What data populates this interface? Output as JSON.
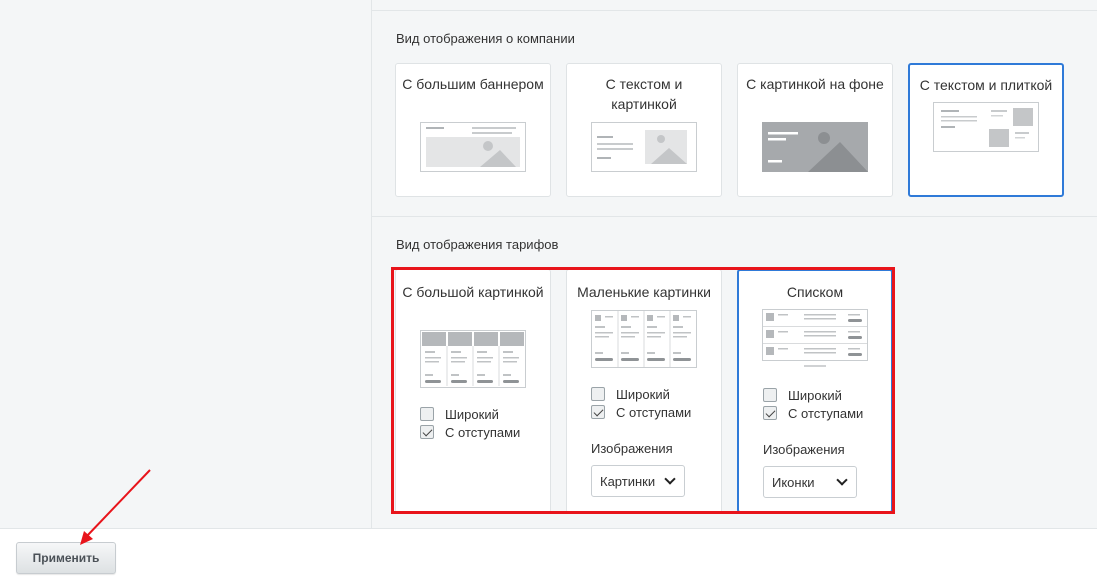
{
  "company_section": {
    "title": "Вид отображения о компании",
    "cards": [
      {
        "label": "С большим баннером",
        "selected": false
      },
      {
        "label": "С текстом и картинкой",
        "selected": false
      },
      {
        "label": "С картинкой на фоне",
        "selected": false
      },
      {
        "label": "С текстом и плиткой",
        "selected": true
      }
    ]
  },
  "tariff_section": {
    "title": "Вид отображения тарифов",
    "cards": [
      {
        "label": "С большой картинкой",
        "selected": false,
        "wide_label": "Широкий",
        "wide_checked": false,
        "padding_label": "С отступами",
        "padding_checked": true
      },
      {
        "label": "Маленькие картинки",
        "selected": false,
        "wide_label": "Широкий",
        "wide_checked": false,
        "padding_label": "С отступами",
        "padding_checked": true,
        "images_label": "Изображения",
        "images_value": "Картинки"
      },
      {
        "label": "Списком",
        "selected": true,
        "wide_label": "Широкий",
        "wide_checked": false,
        "padding_label": "С отступами",
        "padding_checked": true,
        "images_label": "Изображения",
        "images_value": "Иконки"
      }
    ]
  },
  "footer": {
    "apply_label": "Применить"
  },
  "colors": {
    "selected_border": "#2f7ad8",
    "annotation_red": "#e8141b",
    "background": "#f4f6f7"
  }
}
